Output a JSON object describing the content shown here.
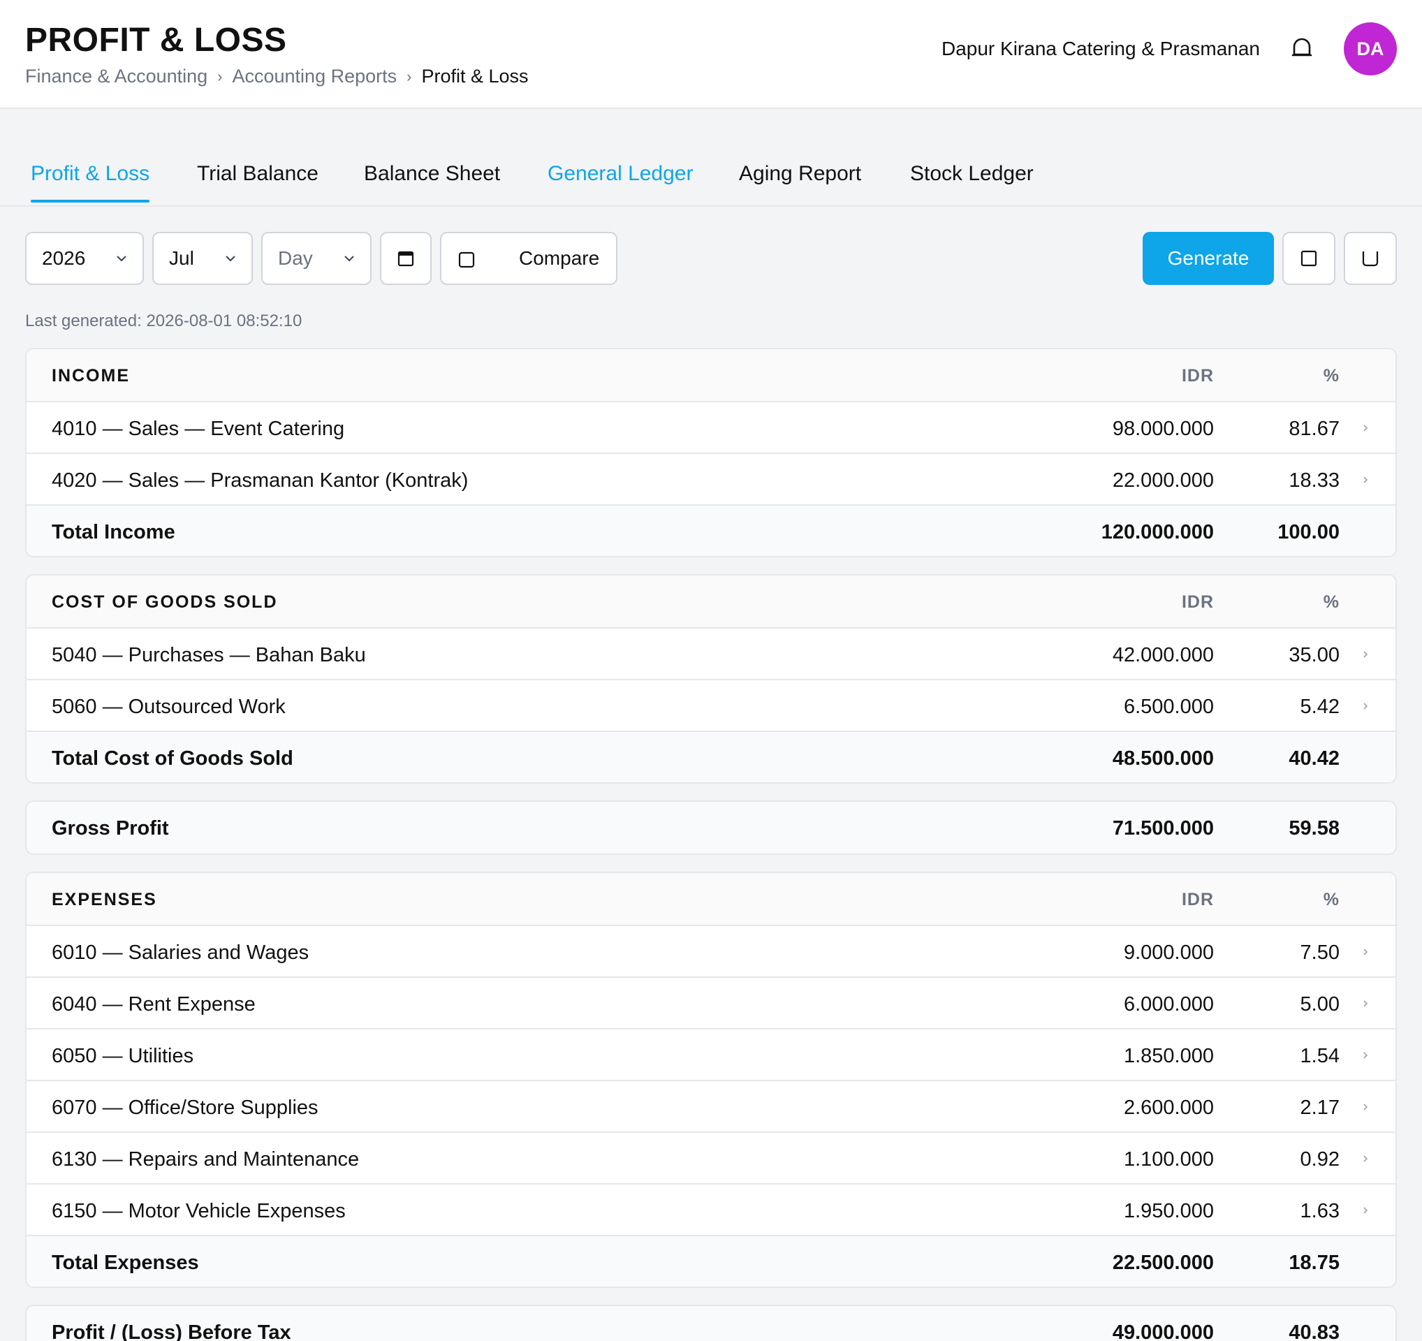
{
  "header": {
    "title": "PROFIT & LOSS",
    "breadcrumb": [
      "Finance & Accounting",
      "Accounting Reports",
      "Profit & Loss"
    ],
    "company": "Dapur Kirana Catering & Prasmanan",
    "avatar_initials": "DA",
    "avatar_color": "#c026d3"
  },
  "tabs": [
    {
      "label": "Profit & Loss",
      "active": true
    },
    {
      "label": "Trial Balance"
    },
    {
      "label": "Balance Sheet"
    },
    {
      "label": "General Ledger"
    },
    {
      "label": "Aging Report"
    },
    {
      "label": "Stock Ledger"
    }
  ],
  "toolbar": {
    "year": "2026",
    "month": "Jul",
    "day_placeholder": "Day",
    "compare_label": "Compare",
    "generate_label": "Generate",
    "accent": "#0ea5e9"
  },
  "last_generated": "Last generated: 2026-08-01 08:52:10",
  "columns": {
    "amount": "IDR",
    "percent": "%"
  },
  "sections": {
    "income": {
      "title": "INCOME",
      "rows": [
        {
          "name": "4010 — Sales — Event Catering",
          "amount": "98.000.000",
          "pct": "81.67"
        },
        {
          "name": "4020 — Sales — Prasmanan Kantor (Kontrak)",
          "amount": "22.000.000",
          "pct": "18.33"
        }
      ],
      "total": {
        "name": "Total Income",
        "amount": "120.000.000",
        "pct": "100.00"
      }
    },
    "cogs": {
      "title": "COST OF GOODS SOLD",
      "rows": [
        {
          "name": "5040 — Purchases — Bahan Baku",
          "amount": "42.000.000",
          "pct": "35.00"
        },
        {
          "name": "5060 — Outsourced Work",
          "amount": "6.500.000",
          "pct": "5.42"
        }
      ],
      "total": {
        "name": "Total Cost of Goods Sold",
        "amount": "48.500.000",
        "pct": "40.42"
      }
    },
    "gross_profit": {
      "name": "Gross Profit",
      "amount": "71.500.000",
      "pct": "59.58"
    },
    "expenses": {
      "title": "EXPENSES",
      "rows": [
        {
          "name": "6010 — Salaries and Wages",
          "amount": "9.000.000",
          "pct": "7.50"
        },
        {
          "name": "6040 — Rent Expense",
          "amount": "6.000.000",
          "pct": "5.00"
        },
        {
          "name": "6050 — Utilities",
          "amount": "1.850.000",
          "pct": "1.54"
        },
        {
          "name": "6070 — Office/Store Supplies",
          "amount": "2.600.000",
          "pct": "2.17"
        },
        {
          "name": "6130 — Repairs and Maintenance",
          "amount": "1.100.000",
          "pct": "0.92"
        },
        {
          "name": "6150 — Motor Vehicle Expenses",
          "amount": "1.950.000",
          "pct": "1.63"
        }
      ],
      "total": {
        "name": "Total Expenses",
        "amount": "22.500.000",
        "pct": "18.75"
      }
    },
    "profit_before_tax": {
      "name": "Profit / (Loss) Before Tax",
      "amount": "49.000.000",
      "pct": "40.83"
    }
  }
}
